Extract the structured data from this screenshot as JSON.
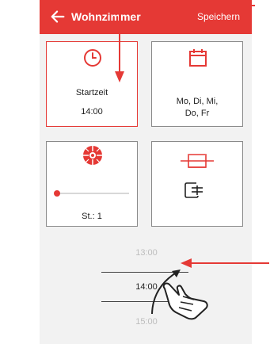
{
  "appbar": {
    "title": "Wohnzimmer",
    "save_label": "Speichern",
    "color": "#e53935"
  },
  "cards": {
    "start": {
      "label": "Startzeit",
      "value": "14:00",
      "icon": "clock-icon"
    },
    "days": {
      "value": "Mo, Di, Mi, Do, Fr",
      "line1": "Mo, Di, Mi,",
      "line2": "Do, Fr",
      "icon": "calendar-icon"
    },
    "level": {
      "label": "St.: 1",
      "icon": "fan-icon",
      "slider_level": 0
    },
    "mode": {
      "icon_top": "switch-icon",
      "icon_bottom": "enter-box-icon"
    }
  },
  "picker": {
    "items": [
      "13:00",
      "14:00",
      "15:00"
    ]
  },
  "overlay": {
    "gesture": "hand-swipe-icon",
    "arrows": [
      "pointer-arrow-icon",
      "pointer-arrow-icon"
    ]
  }
}
